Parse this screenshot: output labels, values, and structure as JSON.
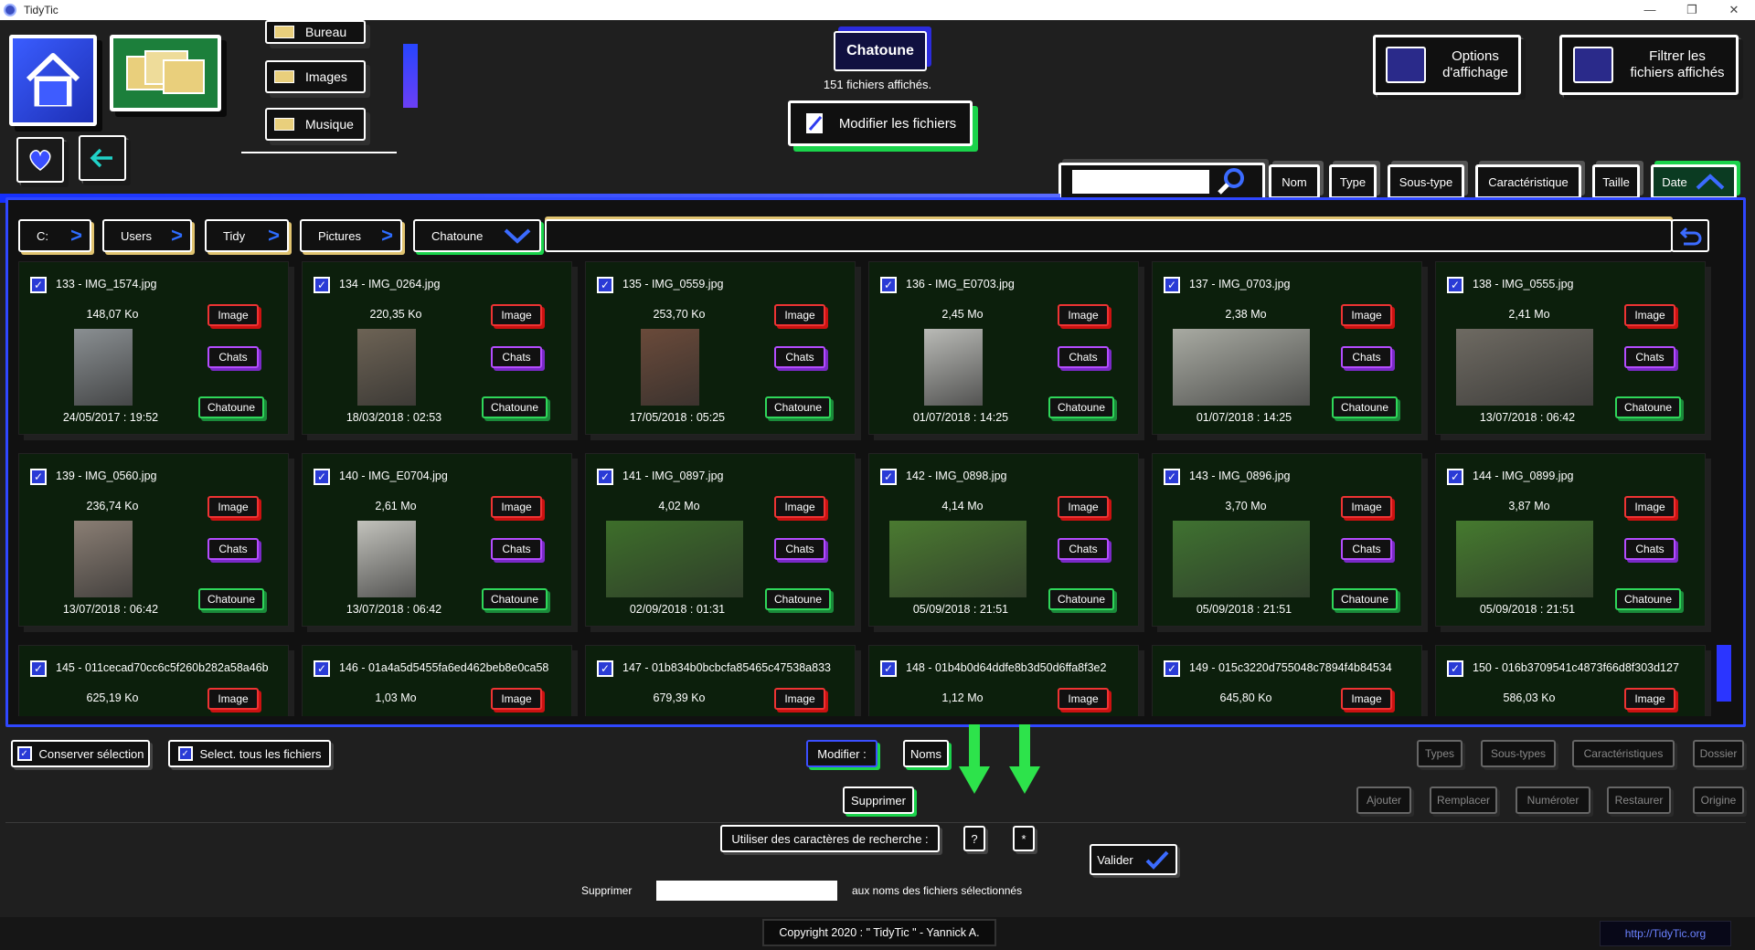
{
  "window": {
    "title": "TidyTic",
    "controls": [
      "—",
      "❐",
      "✕"
    ]
  },
  "shortcuts": {
    "items": [
      {
        "label": "Bureau"
      },
      {
        "label": "Images"
      },
      {
        "label": "Musique"
      }
    ]
  },
  "header": {
    "folder_name": "Chatoune",
    "count_text": "151 fichiers affichés.",
    "modify_label": "Modifier les fichiers",
    "options_label_1": "Options",
    "options_label_2": "d'affichage",
    "filter_label_1": "Filtrer les",
    "filter_label_2": "fichiers affichés"
  },
  "sort": {
    "buttons": [
      "Nom",
      "Type",
      "Sous-type",
      "Caractéristique",
      "Taille",
      "Date"
    ],
    "active": "Date"
  },
  "breadcrumb": [
    "C:",
    "Users",
    "Tidy",
    "Pictures",
    "Chatoune"
  ],
  "tags": {
    "type": "Image",
    "subtype": "Chats",
    "feature": "Chatoune"
  },
  "files": [
    {
      "name": "133 - IMG_1574.jpg",
      "size": "148,07 Ko",
      "date": "24/05/2017 : 19:52",
      "orient": "portrait",
      "color": "#8a8f92"
    },
    {
      "name": "134 - IMG_0264.jpg",
      "size": "220,35 Ko",
      "date": "18/03/2018 : 02:53",
      "orient": "portrait",
      "color": "#6d6355"
    },
    {
      "name": "135 - IMG_0559.jpg",
      "size": "253,70 Ko",
      "date": "17/05/2018 : 05:25",
      "orient": "portrait",
      "color": "#6a4a3a"
    },
    {
      "name": "136 - IMG_E0703.jpg",
      "size": "2,45 Mo",
      "date": "01/07/2018 : 14:25",
      "orient": "portrait",
      "color": "#b9bab6"
    },
    {
      "name": "137 - IMG_0703.jpg",
      "size": "2,38 Mo",
      "date": "01/07/2018 : 14:25",
      "orient": "landscape",
      "color": "#a8aaa2"
    },
    {
      "name": "138 - IMG_0555.jpg",
      "size": "2,41 Mo",
      "date": "13/07/2018 : 06:42",
      "orient": "landscape",
      "color": "#6e6a62"
    },
    {
      "name": "139 - IMG_0560.jpg",
      "size": "236,74 Ko",
      "date": "13/07/2018 : 06:42",
      "orient": "portrait",
      "color": "#8a7e74"
    },
    {
      "name": "140 - IMG_E0704.jpg",
      "size": "2,61 Mo",
      "date": "13/07/2018 : 06:42",
      "orient": "portrait",
      "color": "#c2c2bc"
    },
    {
      "name": "141 - IMG_0897.jpg",
      "size": "4,02 Mo",
      "date": "02/09/2018 : 01:31",
      "orient": "landscape",
      "color": "#3d6e2a"
    },
    {
      "name": "142 - IMG_0898.jpg",
      "size": "4,14 Mo",
      "date": "05/09/2018 : 21:51",
      "orient": "landscape",
      "color": "#4a7a30"
    },
    {
      "name": "143 - IMG_0896.jpg",
      "size": "3,70 Mo",
      "date": "05/09/2018 : 21:51",
      "orient": "landscape",
      "color": "#3f7230"
    },
    {
      "name": "144 - IMG_0899.jpg",
      "size": "3,87 Mo",
      "date": "05/09/2018 : 21:51",
      "orient": "landscape",
      "color": "#457a2e"
    },
    {
      "name": "145 - 011cecad70cc6c5f260b282a58a46b",
      "size": "625,19 Ko",
      "date": "",
      "orient": "none",
      "color": ""
    },
    {
      "name": "146 - 01a4a5d5455fa6ed462beb8e0ca58",
      "size": "1,03 Mo",
      "date": "",
      "orient": "none",
      "color": ""
    },
    {
      "name": "147 - 01b834b0bcbcfa85465c47538a833",
      "size": "679,39 Ko",
      "date": "",
      "orient": "none",
      "color": ""
    },
    {
      "name": "148 - 01b4b0d64ddfe8b3d50d6ffa8f3e2",
      "size": "1,12 Mo",
      "date": "",
      "orient": "none",
      "color": ""
    },
    {
      "name": "149 - 015c3220d755048c7894f4b84534",
      "size": "645,80 Ko",
      "date": "",
      "orient": "none",
      "color": ""
    },
    {
      "name": "150 - 016b3709541c4873f66d8f303d127",
      "size": "586,03 Ko",
      "date": "",
      "orient": "none",
      "color": ""
    }
  ],
  "bottom": {
    "keep_selection": "Conserver sélection",
    "select_all": "Select. tous les fichiers",
    "modify": "Modifier :",
    "names": "Noms",
    "types": "Types",
    "subtypes": "Sous-types",
    "features": "Caractéristiques",
    "folder": "Dossier",
    "delete": "Supprimer",
    "add": "Ajouter",
    "replace": "Remplacer",
    "number": "Numéroter",
    "restore": "Restaurer",
    "origin": "Origine",
    "search_chars": "Utiliser des caractères de recherche :",
    "q_char": "?",
    "star_char": "*",
    "del_label": "Supprimer",
    "del_input_value": "",
    "del_suffix": "aux noms des fichiers sélectionnés",
    "validate": "Valider"
  },
  "footer": {
    "copyright": "Copyright 2020 : \" TidyTic \" - Yannick A.",
    "link": "http://TidyTic.org"
  },
  "colors": {
    "accent_blue": "#2e3cf0",
    "accent_green": "#1ad34b",
    "tag_red": "#e33333",
    "tag_purple": "#b44cff"
  }
}
